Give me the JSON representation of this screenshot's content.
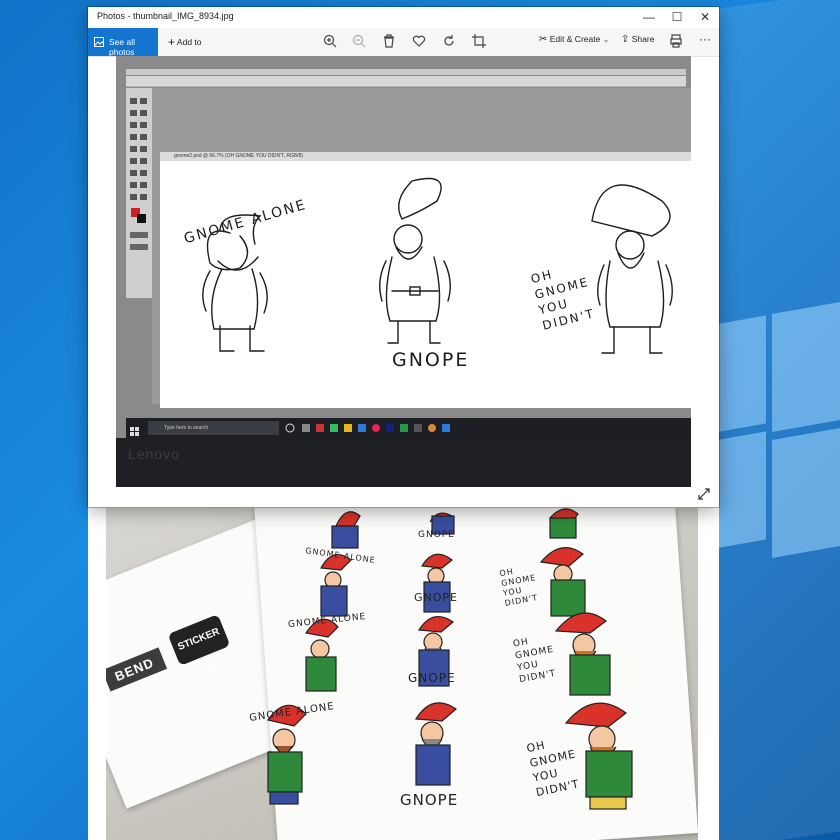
{
  "window": {
    "title": "Photos - thumbnail_IMG_8934.jpg",
    "controls": {
      "minimize": "—",
      "maximize": "☐",
      "close": "✕"
    }
  },
  "toolbar": {
    "see_all_photos": "See all photos",
    "add_to": "Add to",
    "edit_create": "Edit & Create",
    "share": "Share",
    "more": "···",
    "icons": [
      "zoom-in-icon",
      "zoom-out-icon",
      "delete-icon",
      "heart-icon",
      "rotate-icon",
      "crop-icon",
      "edit-create-icon",
      "share-icon",
      "print-icon"
    ]
  },
  "photo_top": {
    "doc_tab": "gnome2.psd @ 66.7% (OH GNOME YOU DIDN'T, RGB/8)",
    "texts": {
      "gnome_alone": "GNOME ALONE",
      "gnope": "GNOPE",
      "oh_gnome": [
        "OH",
        "GNOME",
        "YOU",
        "DIDN'T"
      ]
    },
    "taskbar_search": "Type here to search",
    "brand": "Lenovo"
  },
  "photo_bottom": {
    "bend_label": "BEND",
    "sticker_logo": "STICKER YOU",
    "texts": {
      "gnome_alone": "GNOME ALONE",
      "gnope": "GNOPE",
      "oh_gnome": [
        "OH",
        "GNOME",
        "YOU",
        "DIDN'T"
      ]
    }
  },
  "colors": {
    "accent": "#1475d1",
    "desktop": "#1173c8",
    "gnome_hat": "#d8322a",
    "gnome_coat_green": "#2e8a3a",
    "gnome_coat_blue": "#3a4ea0"
  }
}
